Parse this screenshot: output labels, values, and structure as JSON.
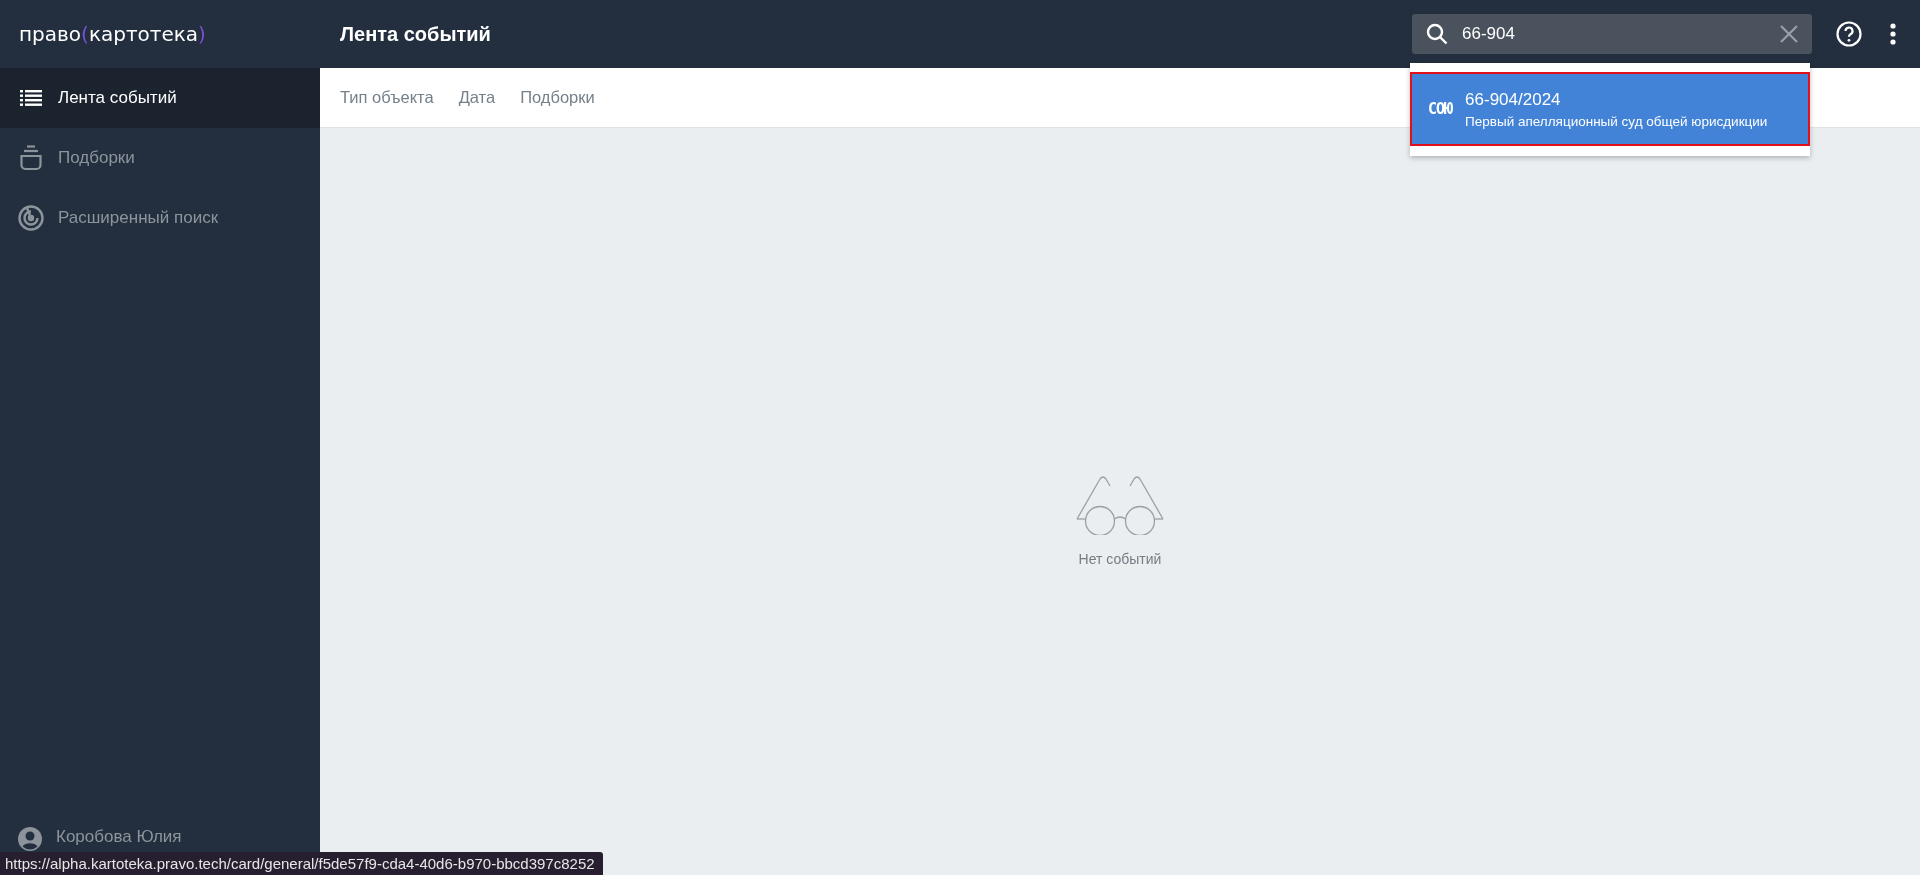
{
  "logo": {
    "text_1": "право",
    "bracket_open": "(",
    "text_2": "картотека",
    "bracket_close": ")"
  },
  "page_title": "Лента событий",
  "sidebar": {
    "items": [
      {
        "label": "Лента событий",
        "kind": "list",
        "selected": true
      },
      {
        "label": "Подборки",
        "kind": "stack",
        "selected": false
      },
      {
        "label": "Расширенный поиск",
        "kind": "radar",
        "selected": false
      }
    ],
    "user": "Коробова Юлия"
  },
  "filters": [
    {
      "label": "Тип объекта"
    },
    {
      "label": "Дата"
    },
    {
      "label": "Подборки"
    }
  ],
  "search": {
    "value": "66-904"
  },
  "suggestions": [
    {
      "badge": "СОЮ",
      "number": "66-904/2024",
      "court": "Первый апелляционный суд общей юрисдикции",
      "selected": true
    }
  ],
  "empty_state": "Нет событий",
  "status_bar": "https://alpha.kartoteka.pravo.tech/card/general/f5de57f9-cda4-40d6-b970-bbcd397c8252"
}
